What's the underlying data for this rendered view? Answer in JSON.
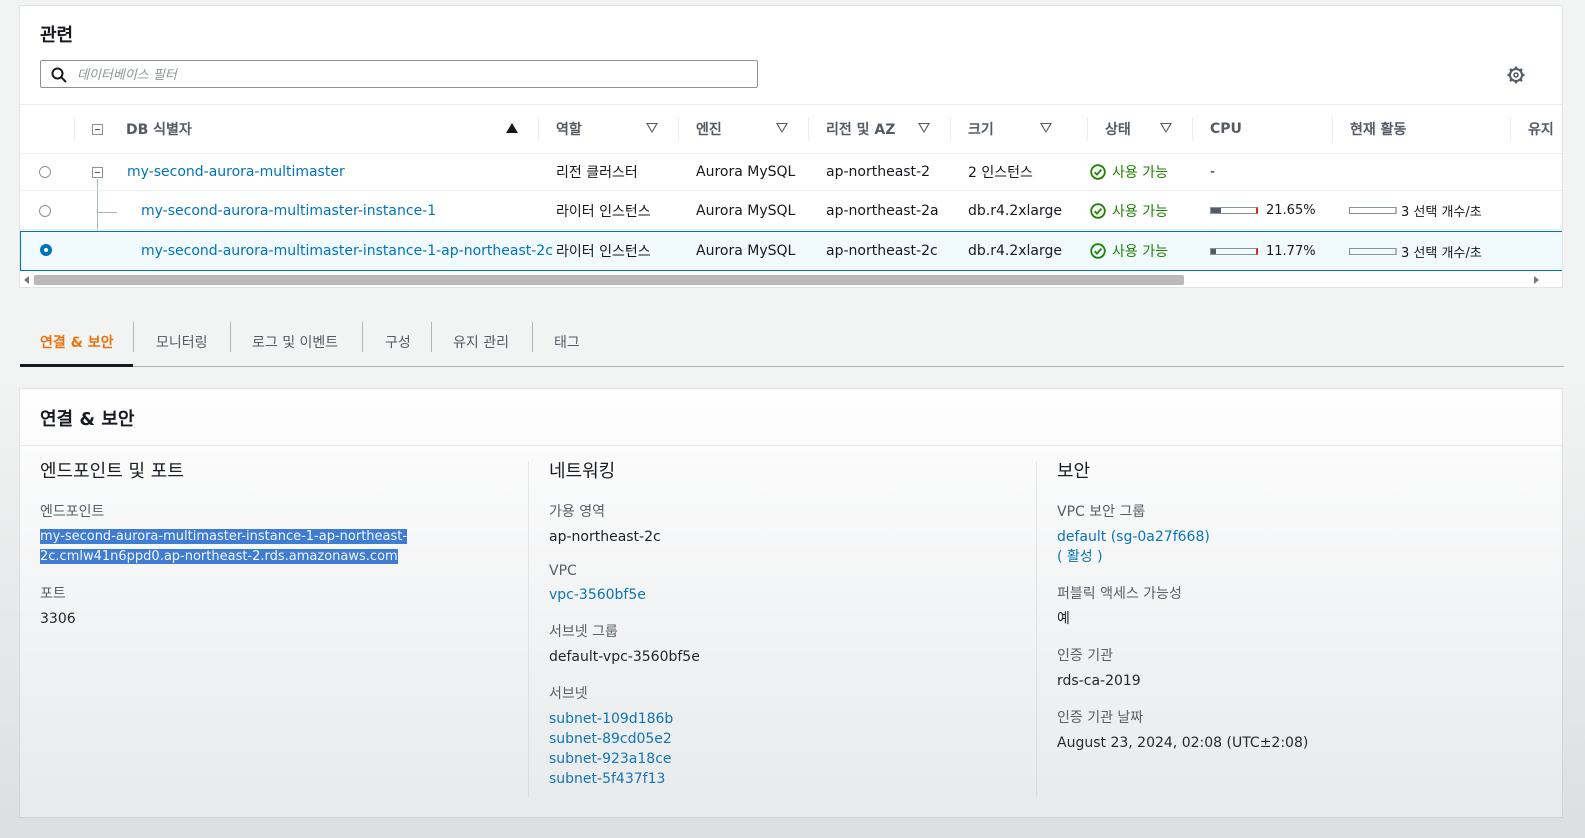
{
  "related": {
    "title": "관련",
    "search_placeholder": "데이터베이스 필터",
    "columns": [
      "DB 식별자",
      "역할",
      "엔진",
      "리전 및 AZ",
      "크기",
      "상태",
      "CPU",
      "현재 활동",
      "유지"
    ],
    "rows": [
      {
        "id": "my-second-aurora-multimaster",
        "role": "리전 클러스터",
        "engine": "Aurora MySQL",
        "region": "ap-northeast-2",
        "size": "2 인스턴스",
        "status": "사용 가능",
        "cpu": "-",
        "activity": ""
      },
      {
        "id": "my-second-aurora-multimaster-instance-1",
        "role": "라이터 인스턴스",
        "engine": "Aurora MySQL",
        "region": "ap-northeast-2a",
        "size": "db.r4.2xlarge",
        "status": "사용 가능",
        "cpu": "21.65%",
        "cpu_value": 21.65,
        "activity": "3 선택 개수/초"
      },
      {
        "id": "my-second-aurora-multimaster-instance-1-ap-northeast-2c",
        "role": "라이터 인스턴스",
        "engine": "Aurora MySQL",
        "region": "ap-northeast-2c",
        "size": "db.r4.2xlarge",
        "status": "사용 가능",
        "cpu": "11.77%",
        "cpu_value": 11.77,
        "activity": "3 선택 개수/초"
      }
    ],
    "selected_row": 2
  },
  "tabs": [
    "연결 & 보안",
    "모니터링",
    "로그 및 이벤트",
    "구성",
    "유지 관리",
    "태그"
  ],
  "active_tab": 0,
  "details": {
    "title": "연결 & 보안",
    "endpoint_section": {
      "title": "엔드포인트 및 포트",
      "endpoint_label": "엔드포인트",
      "endpoint_line1": "my-second-aurora-multimaster-instance-1-ap-northeast-",
      "endpoint_line2": "2c.cmlw41n6ppd0.ap-northeast-2.rds.amazonaws.com",
      "port_label": "포트",
      "port_value": "3306"
    },
    "network_section": {
      "title": "네트워킹",
      "az_label": "가용 영역",
      "az_value": "ap-northeast-2c",
      "vpc_label": "VPC",
      "vpc_value": "vpc-3560bf5e",
      "subnet_group_label": "서브넷 그룹",
      "subnet_group_value": "default-vpc-3560bf5e",
      "subnets_label": "서브넷",
      "subnets": [
        "subnet-109d186b",
        "subnet-89cd05e2",
        "subnet-923a18ce",
        "subnet-5f437f13"
      ]
    },
    "security_section": {
      "title": "보안",
      "vpc_sg_label": "VPC 보안 그룹",
      "vpc_sg_value": "default (sg-0a27f668)",
      "vpc_sg_state": "( 활성 )",
      "public_label": "퍼블릭 액세스 가능성",
      "public_value": "예",
      "ca_label": "인증 기관",
      "ca_value": "rds-ca-2019",
      "ca_date_label": "인증 기관 날짜",
      "ca_date_value": "August 23, 2024, 02:08 (UTC±2:08)"
    }
  },
  "colors": {
    "link": "#0073bb",
    "ok": "#1d8102",
    "active_tab": "#ec7211",
    "selection": "#3b7bd9"
  }
}
